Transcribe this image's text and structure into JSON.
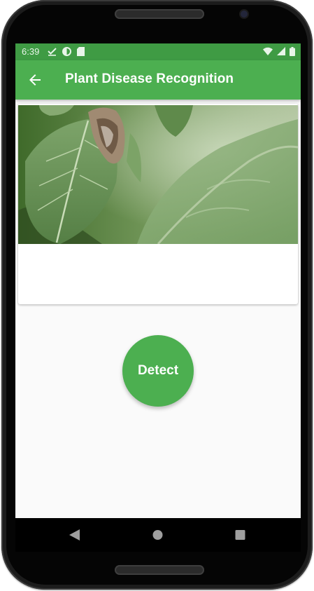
{
  "status_bar": {
    "time": "6:39",
    "icons_left": [
      "check-icon",
      "circle-half-icon",
      "sd-card-icon"
    ],
    "icons_right": [
      "wifi-icon",
      "signal-icon",
      "battery-icon"
    ]
  },
  "app_bar": {
    "title": "Plant Disease Recognition",
    "back_icon": "arrow-left-icon"
  },
  "main": {
    "card_image": "leaf-photo",
    "detect_label": "Detect"
  },
  "nav_bar": {
    "icons": [
      "back-triangle-icon",
      "home-circle-icon",
      "recents-square-icon"
    ]
  },
  "colors": {
    "primary": "#4caf50",
    "status_bar": "#3f9b44",
    "background": "#fafafa"
  }
}
